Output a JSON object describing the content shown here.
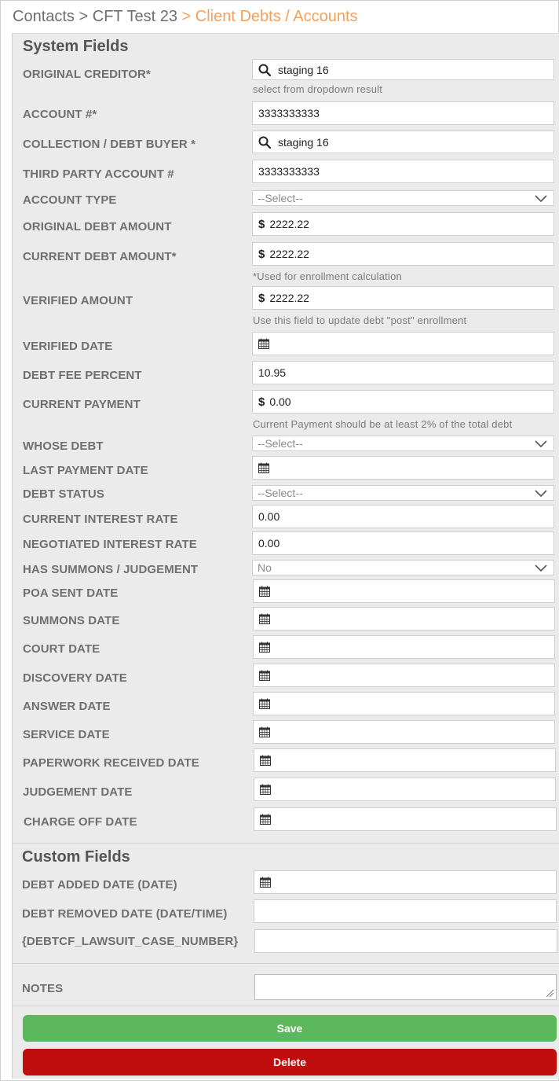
{
  "breadcrumb": {
    "items": [
      "Contacts",
      "CFT Test 23"
    ],
    "separator": ">",
    "active": "> Client Debts / Accounts"
  },
  "system_section": {
    "title": "System Fields"
  },
  "custom_section": {
    "title": "Custom Fields"
  },
  "fields": {
    "original_creditor": {
      "label": "ORIGINAL CREDITOR*",
      "value": "staging 16",
      "hint": "select from dropdown result",
      "icon": "search-icon"
    },
    "account_number": {
      "label": "ACCOUNT #*",
      "value": "3333333333"
    },
    "collection_debt_buyer": {
      "label": "COLLECTION / DEBT BUYER *",
      "value": "staging 16",
      "icon": "search-icon"
    },
    "third_party_account": {
      "label": "THIRD PARTY ACCOUNT #",
      "value": "3333333333"
    },
    "account_type": {
      "label": "ACCOUNT TYPE",
      "value": "--Select--"
    },
    "original_debt_amount": {
      "label": "ORIGINAL DEBT AMOUNT",
      "prefix": "$",
      "value": "2222.22"
    },
    "current_debt_amount": {
      "label": "CURRENT DEBT AMOUNT*",
      "prefix": "$",
      "value": "2222.22",
      "hint": "*Used for enrollment calculation"
    },
    "verified_amount": {
      "label": "VERIFIED AMOUNT",
      "prefix": "$",
      "value": "2222.22",
      "hint": "Use this field to update debt \"post\" enrollment"
    },
    "verified_date": {
      "label": "VERIFIED DATE",
      "value": ""
    },
    "debt_fee_percent": {
      "label": "DEBT FEE PERCENT",
      "value": "10.95"
    },
    "current_payment": {
      "label": "CURRENT PAYMENT",
      "prefix": "$",
      "value": "0.00",
      "hint": "Current Payment should be at least 2% of the total debt"
    },
    "whose_debt": {
      "label": "WHOSE DEBT",
      "value": "--Select--"
    },
    "last_payment_date": {
      "label": "LAST PAYMENT DATE",
      "value": ""
    },
    "debt_status": {
      "label": "DEBT STATUS",
      "value": "--Select--"
    },
    "current_interest_rate": {
      "label": "CURRENT INTEREST RATE",
      "value": "0.00"
    },
    "negotiated_interest_rate": {
      "label": "NEGOTIATED INTEREST RATE",
      "value": "0.00"
    },
    "has_summons": {
      "label": "HAS SUMMONS / JUDGEMENT",
      "value": "No"
    },
    "poa_sent_date": {
      "label": "POA SENT DATE",
      "value": ""
    },
    "summons_date": {
      "label": "SUMMONS DATE",
      "value": ""
    },
    "court_date": {
      "label": "COURT DATE",
      "value": ""
    },
    "discovery_date": {
      "label": "DISCOVERY DATE",
      "value": ""
    },
    "answer_date": {
      "label": "ANSWER DATE",
      "value": ""
    },
    "service_date": {
      "label": "SERVICE DATE",
      "value": ""
    },
    "paperwork_received_date": {
      "label": "PAPERWORK RECEIVED DATE",
      "value": ""
    },
    "judgement_date": {
      "label": "JUDGEMENT DATE",
      "value": ""
    },
    "charge_off_date": {
      "label": "CHARGE OFF DATE",
      "value": ""
    },
    "debt_added_date": {
      "label": "DEBT ADDED DATE (DATE)",
      "value": ""
    },
    "debt_removed_date": {
      "label": "DEBT REMOVED DATE (DATE/TIME)",
      "value": ""
    },
    "lawsuit_case_number": {
      "label": "{DEBTCF_LAWSUIT_CASE_NUMBER}",
      "value": ""
    },
    "notes": {
      "label": "NOTES",
      "value": ""
    }
  },
  "buttons": {
    "save": "Save",
    "delete": "Delete"
  },
  "colors": {
    "accent": "#f5a05a",
    "save": "#5cb85c",
    "delete": "#c00d0d",
    "panel": "#ebebeb"
  }
}
